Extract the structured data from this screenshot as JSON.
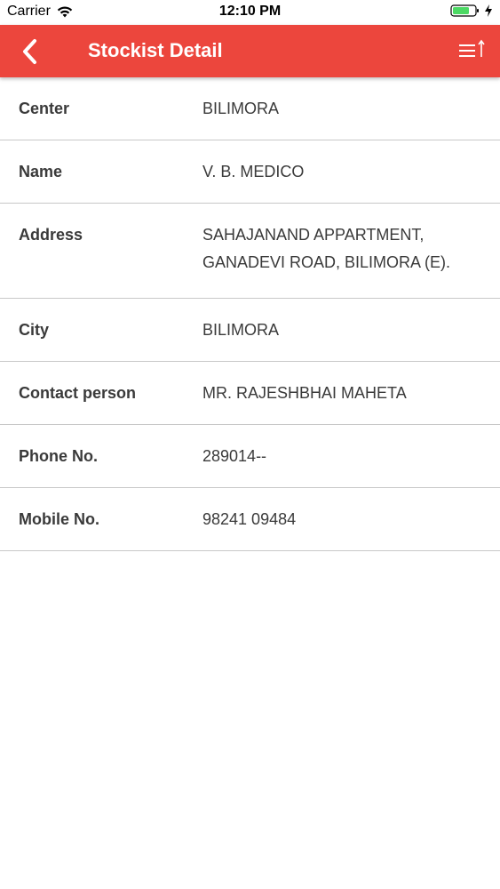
{
  "status_bar": {
    "carrier": "Carrier",
    "time": "12:10 PM"
  },
  "header": {
    "title": "Stockist Detail",
    "back_icon": "chevron-left-icon",
    "menu_icon": "sort-menu-icon",
    "background_color": "#ec463d"
  },
  "details": {
    "center": {
      "label": "Center",
      "value": "BILIMORA"
    },
    "name": {
      "label": "Name",
      "value": "V. B. MEDICO"
    },
    "address": {
      "label": "Address",
      "line1": "SAHAJANAND APPARTMENT,",
      "line2": "GANADEVI ROAD, BILIMORA (E)."
    },
    "city": {
      "label": "City",
      "value": "BILIMORA"
    },
    "contact_person": {
      "label": "Contact person",
      "value": "MR. RAJESHBHAI MAHETA"
    },
    "phone": {
      "label": "Phone No.",
      "value": "289014--"
    },
    "mobile": {
      "label": "Mobile No.",
      "value": "98241 09484"
    }
  }
}
